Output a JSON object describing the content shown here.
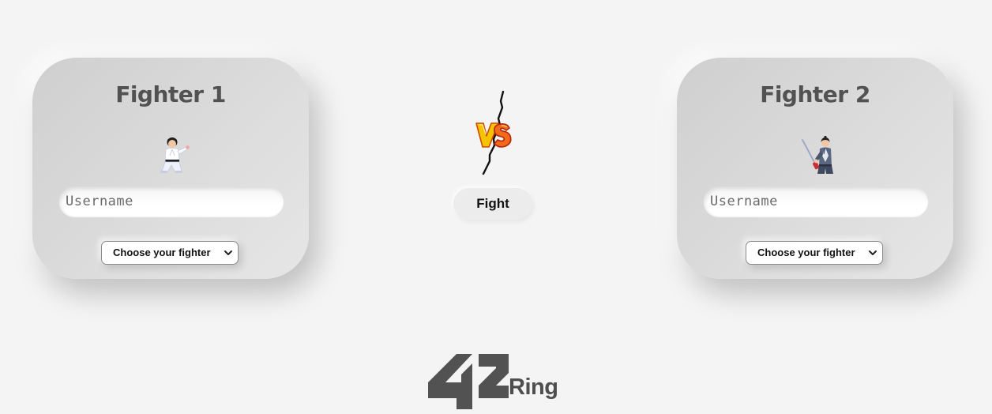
{
  "fighters": [
    {
      "title": "Fighter 1",
      "avatar": "karate-fighter-icon",
      "username_placeholder": "Username",
      "username_value": "",
      "select_label": "Choose your fighter"
    },
    {
      "title": "Fighter 2",
      "avatar": "samurai-fighter-icon",
      "username_placeholder": "Username",
      "username_value": "",
      "select_label": "Choose your fighter"
    }
  ],
  "center": {
    "vs_icon": "versus-icon",
    "fight_label": "Fight"
  },
  "brand": {
    "logo_text": "42",
    "ring_text": "Ring"
  },
  "colors": {
    "background": "#f4f4f4",
    "card": "#d8d8d8",
    "title_text": "#525252",
    "vs_yellow": "#f5c400",
    "vs_red": "#e8341c",
    "brand_gray": "#4e4e4e"
  }
}
